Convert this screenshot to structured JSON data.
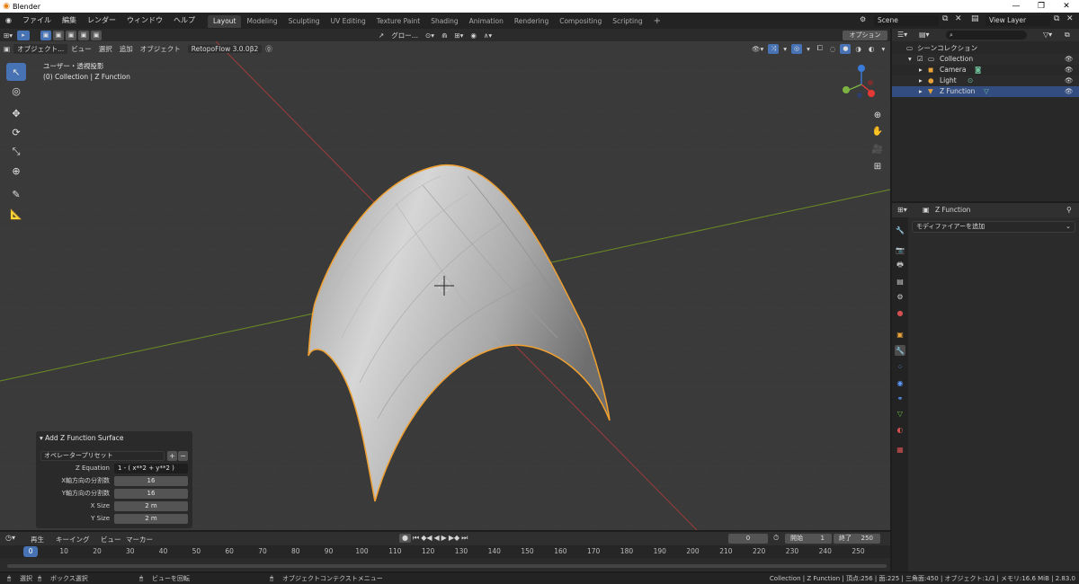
{
  "window": {
    "title": "Blender",
    "minimize": "—",
    "maximize": "❐",
    "close": "✕"
  },
  "menu": [
    "ファイル",
    "編集",
    "レンダー",
    "ウィンドウ",
    "ヘルプ"
  ],
  "workspaces": [
    "Layout",
    "Modeling",
    "Sculpting",
    "UV Editing",
    "Texture Paint",
    "Shading",
    "Animation",
    "Rendering",
    "Compositing",
    "Scripting"
  ],
  "active_workspace": "Layout",
  "scene": {
    "label": "Scene",
    "view_layer": "View Layer"
  },
  "viewport_header": {
    "mode": "オブジェクト...",
    "items": [
      "ビュー",
      "選択",
      "追加",
      "オブジェクト"
    ],
    "addon": "RetopoFlow 3.0.0β2",
    "transform_orientation": "グロー...",
    "options": "オプション"
  },
  "viewport": {
    "view_name": "ユーザー・透視投影",
    "collection_info": "(0) Collection | Z Function",
    "colors": {
      "background": "#3a3a3a",
      "x_axis": "#9e3b3b",
      "y_axis": "#6b8e23",
      "mesh": "#cfcfcf",
      "outline": "#f0a030"
    }
  },
  "operator_panel": {
    "title": "Add Z Function Surface",
    "preset": "オペレータープリセット",
    "rows": [
      {
        "label": "Z Equation",
        "value": "1 - ( x**2 + y**2 )"
      },
      {
        "label": "X軸方向の分割数",
        "value": "16"
      },
      {
        "label": "Y軸方向の分割数",
        "value": "16"
      },
      {
        "label": "X Size",
        "value": "2 m"
      },
      {
        "label": "Y Size",
        "value": "2 m"
      }
    ]
  },
  "outliner": {
    "title": "シーンコレクション",
    "items": [
      {
        "name": "Collection"
      },
      {
        "name": "Camera"
      },
      {
        "name": "Light"
      },
      {
        "name": "Z Function"
      }
    ]
  },
  "properties": {
    "object_name": "Z Function",
    "add_modifier": "モディファイアーを追加"
  },
  "timeline": {
    "menu": [
      "再生",
      "キーイング",
      "ビュー",
      "マーカー"
    ],
    "current_frame": "0",
    "start_label": "開始",
    "start": "1",
    "end_label": "終了",
    "end": "250",
    "ticks": [
      "0",
      "10",
      "20",
      "30",
      "40",
      "50",
      "60",
      "70",
      "80",
      "90",
      "100",
      "110",
      "120",
      "130",
      "140",
      "150",
      "160",
      "170",
      "180",
      "190",
      "200",
      "210",
      "220",
      "230",
      "240",
      "250"
    ]
  },
  "statusbar": {
    "select": "選択",
    "box_select": "ボックス選択",
    "rotate": "ビューを回転",
    "context_menu": "オブジェクトコンテクストメニュー",
    "stats": "Collection | Z Function | 頂点:256 | 面:225 | 三角面:450 | オブジェクト:1/3 | メモリ:16.6 MiB | 2.83.0"
  }
}
